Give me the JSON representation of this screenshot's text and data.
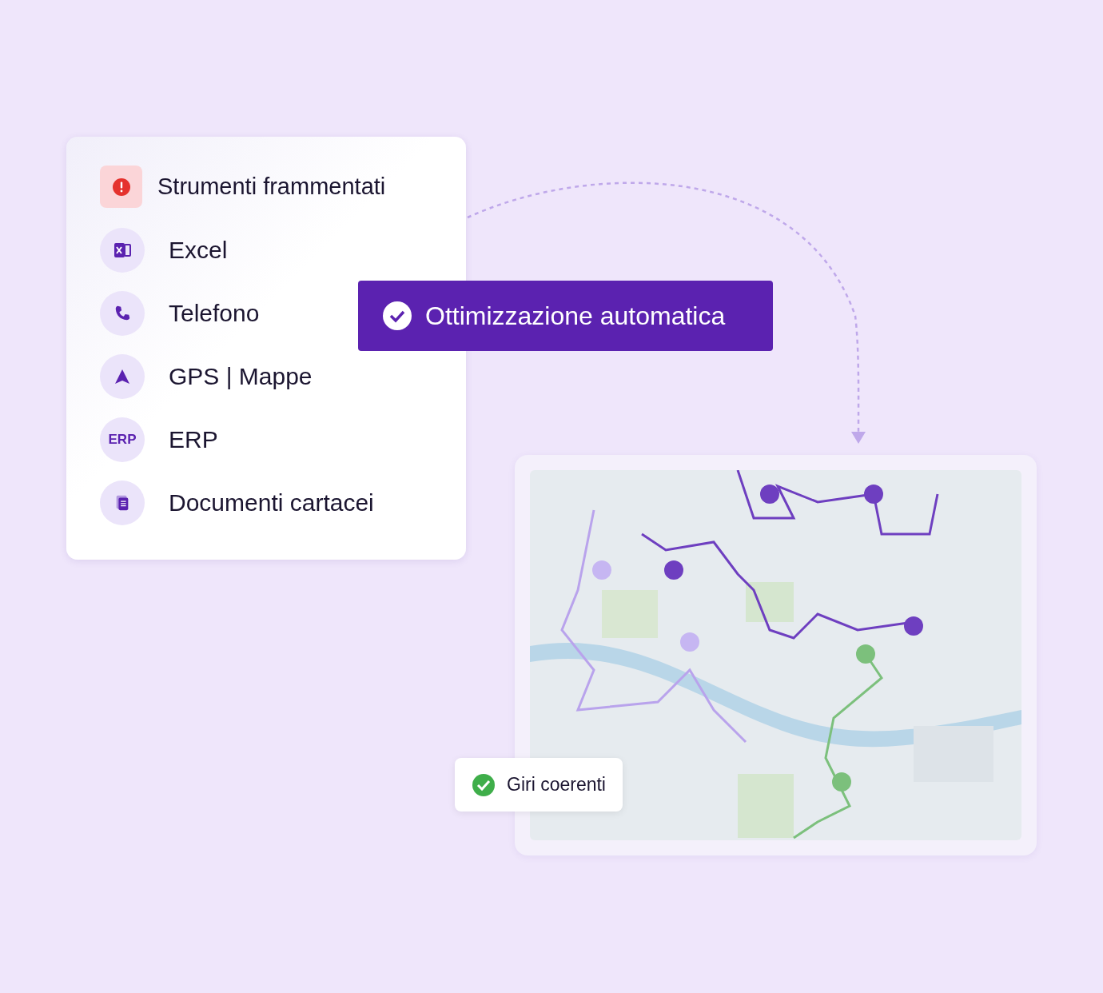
{
  "tools_card": {
    "title": "Strumenti frammentati",
    "items": [
      {
        "kind": "excel",
        "label": "Excel"
      },
      {
        "kind": "phone",
        "label": "Telefono"
      },
      {
        "kind": "gps",
        "label": "GPS | Mappe"
      },
      {
        "kind": "text",
        "icon_text": "ERP",
        "label": "ERP"
      },
      {
        "kind": "docs",
        "label": "Documenti cartacei"
      }
    ]
  },
  "optimization_badge": {
    "label": "Ottimizzazione automatica"
  },
  "result_chip": {
    "label": "Giri coerenti"
  }
}
